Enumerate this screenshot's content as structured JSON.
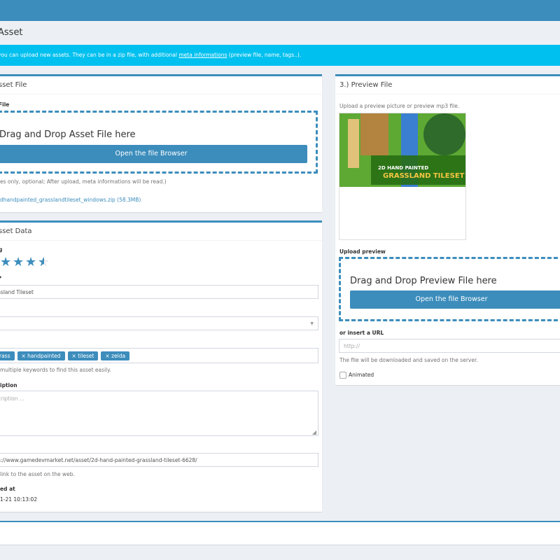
{
  "header": {
    "page_title": "Asset"
  },
  "callout": {
    "text_before": "you can upload new assets. They can be in a zip file, with additional ",
    "link": "meta informations",
    "text_after": " (preview file, name, tags..)."
  },
  "asset_file": {
    "title": "sset File",
    "label": "File",
    "dropzone_text": "Drag and Drop Asset File here",
    "browse_button": "Open the file Browser",
    "help": "es only, optional; After upload, meta informations will be read.)",
    "file_link": "dhandpainted_grasslandtileset_windows.zip (58.3MB)"
  },
  "asset_data": {
    "title": "sset Data",
    "rating_label": "g",
    "rating_value": 4.5,
    "rating_max": 5,
    "name_label": "•",
    "name_value": "ssland Tileset",
    "select_value": "",
    "tags": [
      "rass",
      "× handpainted",
      "× tileset",
      "× zelda"
    ],
    "tags_help": "multiple keywords to find this asset easily.",
    "description_label": "iption",
    "description_placeholder": "cription ...",
    "url_value": "s://www.gamedevmarket.net/asset/2d-hand-painted-grassland-tileset-6628/",
    "url_help": "link to the asset on the web.",
    "created_label": "ed at",
    "created_value": "1-21 10:13:02"
  },
  "preview_file": {
    "title": "3.) Preview File",
    "help": "Upload a preview picture or preview mp3 file.",
    "image_line1": "2D HAND PAINTED",
    "image_line2": "GRASSLAND TILESET",
    "upload_label": "Upload preview",
    "dropzone_text": "Drag and Drop Preview File here",
    "browse_button": "Open the file Browser",
    "url_label": "or insert a URL",
    "url_placeholder": "http://",
    "url_help": "The file will be downloaded and saved on the server.",
    "animated_label": "Animated",
    "animated_checked": false
  }
}
